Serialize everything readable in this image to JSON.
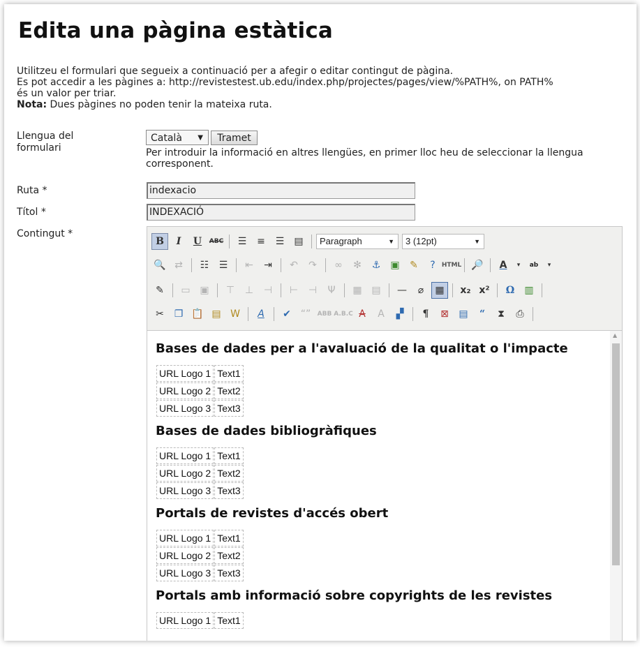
{
  "page": {
    "title": "Edita una pàgina estàtica",
    "intro_line1": "Utilitzeu el formulari que segueix a continuació per a afegir o editar contingut de pàgina.",
    "intro_line2": "Es pot accedir a les pàgines a: http://revistestest.ub.edu/index.php/projectes/pages/view/%PATH%, on PATH%",
    "intro_line3": "és un valor per triar.",
    "note_label": "Nota:",
    "note_text": " Dues pàgines no poden tenir la mateixa ruta."
  },
  "form": {
    "lang_label_1": "Llengua del",
    "lang_label_2": "formulari",
    "lang_value": "Català",
    "submit_label": "Tramet",
    "lang_help": "Per introduir la informació en altres llengües, en primer lloc heu de seleccionar la llengua corresponent.",
    "path_label": "Ruta *",
    "path_value": "indexacio",
    "title_label": "Títol *",
    "title_value": "INDEXACIÓ",
    "content_label": "Contingut *"
  },
  "editor": {
    "format_value": "Paragraph",
    "fontsize_value": "3 (12pt)",
    "sections": [
      {
        "heading": "Bases de dades per a l'avaluació de la qualitat o l'impacte",
        "rows": [
          [
            "URL Logo 1",
            "Text1"
          ],
          [
            "URL Logo 2",
            "Text2"
          ],
          [
            "URL Logo 3",
            "Text3"
          ]
        ]
      },
      {
        "heading": "Bases de dades bibliogràfiques",
        "rows": [
          [
            "URL Logo 1",
            "Text1"
          ],
          [
            "URL Logo 2",
            "Text2"
          ],
          [
            "URL Logo 3",
            "Text3"
          ]
        ]
      },
      {
        "heading": "Portals de revistes d'accés obert",
        "rows": [
          [
            "URL Logo 1",
            "Text1"
          ],
          [
            "URL Logo 2",
            "Text2"
          ],
          [
            "URL Logo 3",
            "Text3"
          ]
        ]
      },
      {
        "heading": "Portals amb informació sobre copyrights de les revistes",
        "rows": [
          [
            "URL Logo 1",
            "Text1"
          ]
        ]
      }
    ]
  }
}
